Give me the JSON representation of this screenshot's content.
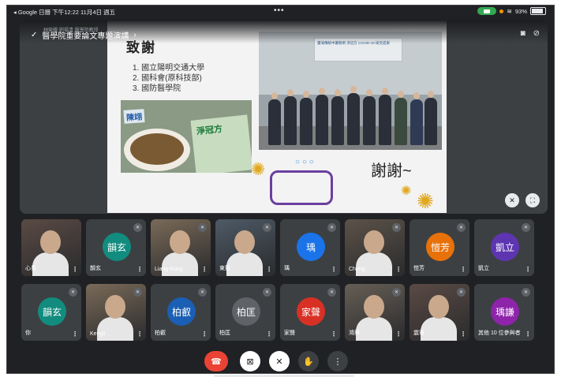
{
  "status_bar": {
    "left": "◂ Google 日曆  下午12:22  11月4日 週五",
    "dots": "•••",
    "battery_text": "93%"
  },
  "meeting": {
    "title": "醫學院重要論文專題演講",
    "chevron": "›",
    "subtitle": "林榮耀‧劉福清 醫學院教授"
  },
  "slide": {
    "heading": "致謝",
    "items": [
      "1. 國立陽明交通大學",
      "2. 國科會(原科技部)",
      "3. 國防醫學院"
    ],
    "product_label": "淨冠方",
    "product_tag": "陳翊",
    "banner_text": "臺灣傳統中藥製劑 淨冠方 COVID-19 研究成果",
    "thanks": "謝謝~"
  },
  "participants": [
    {
      "name": "心晃",
      "video": true
    },
    {
      "name": "韻玄",
      "initials": "韻玄",
      "color": "#128c7e",
      "muted": true
    },
    {
      "name": "Liang-Kung",
      "video": true,
      "muted": true
    },
    {
      "name": "東毅",
      "video": true,
      "muted": true
    },
    {
      "name": "瑀",
      "initials": "瑀",
      "color": "#1a73e8",
      "muted": true
    },
    {
      "name": "Cheng",
      "video": true,
      "muted": true
    },
    {
      "name": "愷芳",
      "initials": "愷芳",
      "color": "#e8710a",
      "muted": true
    },
    {
      "name": "凱立",
      "initials": "凱立",
      "color": "#5e35b1",
      "muted": true
    },
    {
      "name": "你",
      "initials": "韻玄",
      "color": "#128c7e",
      "muted": true
    },
    {
      "name": "Kengli",
      "video": true,
      "muted": true
    },
    {
      "name": "柏叡",
      "initials": "柏叡",
      "color": "#1a5fb4",
      "muted": true
    },
    {
      "name": "柏匡",
      "initials": "柏匡",
      "color": "#5f6368",
      "muted": true
    },
    {
      "name": "家聲",
      "initials": "家聲",
      "color": "#d93025",
      "muted": true
    },
    {
      "name": "鴻興",
      "video": true,
      "muted": true
    },
    {
      "name": "震寰",
      "video": true,
      "muted": true
    },
    {
      "name": "其他 10 位參與者",
      "initials": "瑀謙",
      "color": "#8e24aa",
      "muted": true
    }
  ],
  "controls": {
    "end_call": "hang-up-icon",
    "camera": "camera-off-icon",
    "mic": "mic-off-icon",
    "hand": "raise-hand-icon",
    "more": "more-vertical-icon"
  },
  "colors": {
    "end_call": "#ea4335",
    "tile_bg": "#3c4043",
    "app_bg": "#202124"
  }
}
